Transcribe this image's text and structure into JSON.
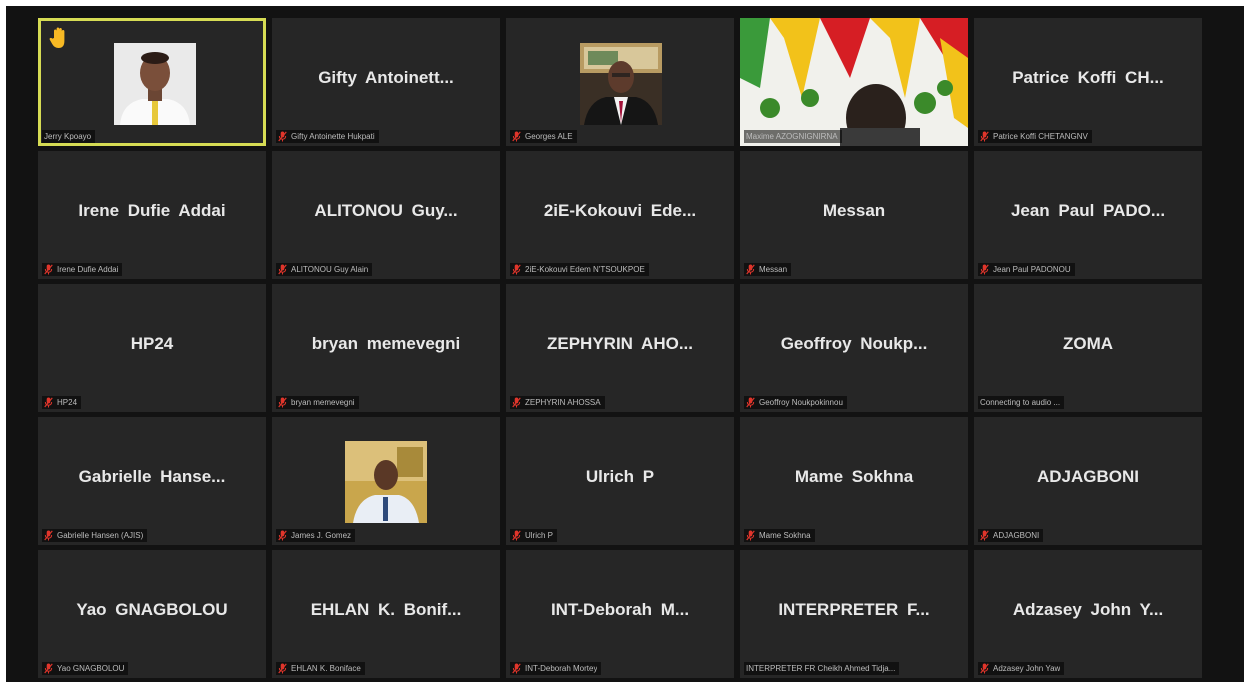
{
  "participants": [
    {
      "display": "",
      "caption": "Jerry Kpoayo",
      "muted": false,
      "raised_hand": true,
      "photo": "avatar-man-white-shirt",
      "active": true
    },
    {
      "display": "Gifty  Antoinett...",
      "caption": "Gifty Antoinette Hukpati",
      "muted": true
    },
    {
      "display": "",
      "caption": "Georges ALE",
      "muted": true,
      "photo": "avatar-man-suit"
    },
    {
      "display": "",
      "caption": "Maxime AZOGNIGNIRNA",
      "muted": false,
      "photo": "video-decorated-room"
    },
    {
      "display": "Patrice Koffi CH...",
      "caption": "Patrice Koffi CHETANGNV",
      "muted": true
    },
    {
      "display": "Irene Dufie Addai",
      "caption": "Irene Dufie Addai",
      "muted": true
    },
    {
      "display": "ALITONOU  Guy...",
      "caption": "ALITONOU Guy Alain",
      "muted": true
    },
    {
      "display": "2iE-Kokouvi  Ede...",
      "caption": "2iE-Kokouvi Edem N'TSOUKPOE",
      "muted": true
    },
    {
      "display": "Messan",
      "caption": "Messan",
      "muted": true
    },
    {
      "display": "Jean  Paul  PADO...",
      "caption": "Jean Paul PADONOU",
      "muted": true
    },
    {
      "display": "HP24",
      "caption": "HP24",
      "muted": true
    },
    {
      "display": "bryan memevegni",
      "caption": "bryan memevegni",
      "muted": true
    },
    {
      "display": "ZEPHYRIN  AHO...",
      "caption": "ZEPHYRIN AHOSSA",
      "muted": true
    },
    {
      "display": "Geoffroy  Noukp...",
      "caption": "Geoffroy Noukpokinnou",
      "muted": true
    },
    {
      "display": "ZOMA",
      "caption": "Connecting to audio ...",
      "muted": false
    },
    {
      "display": "Gabrielle  Hanse...",
      "caption": "Gabrielle Hansen (AJIS)",
      "muted": true
    },
    {
      "display": "",
      "caption": "James J. Gomez",
      "muted": true,
      "photo": "avatar-man-outdoor"
    },
    {
      "display": "Ulrich P",
      "caption": "Ulrich P",
      "muted": true
    },
    {
      "display": "Mame Sokhna",
      "caption": "Mame Sokhna",
      "muted": true
    },
    {
      "display": "ADJAGBONI",
      "caption": "ADJAGBONI",
      "muted": true
    },
    {
      "display": "Yao GNAGBOLOU",
      "caption": "Yao GNAGBOLOU",
      "muted": true
    },
    {
      "display": "EHLAN  K.  Bonif...",
      "caption": "EHLAN K. Boniface",
      "muted": true
    },
    {
      "display": "INT-Deborah  M...",
      "caption": "INT-Deborah Mortey",
      "muted": true
    },
    {
      "display": "INTERPRETER  F...",
      "caption": "INTERPRETER FR Cheikh Ahmed Tidja...",
      "muted": false
    },
    {
      "display": "Adzasey John Y...",
      "caption": "Adzasey John Yaw",
      "muted": true
    }
  ],
  "colors": {
    "background": "#121212",
    "tile": "#262626",
    "active_border": "#d6dc54",
    "mute_icon": "#e0352b",
    "name_text": "#e8e8e8",
    "caption_text": "#bdbdbd"
  },
  "icons": {
    "mute": "microphone-muted-icon",
    "hand": "raised-hand-icon"
  }
}
